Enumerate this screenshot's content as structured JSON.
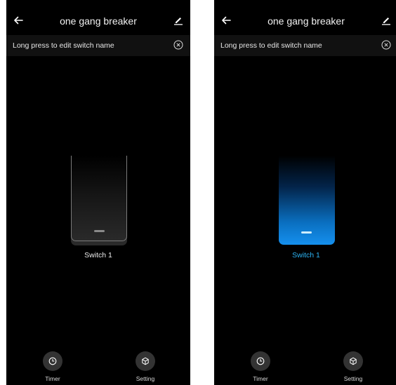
{
  "screens": [
    {
      "title": "one gang breaker",
      "banner": "Long press to edit switch name",
      "switch": {
        "label": "Switch 1",
        "state": "off",
        "color": "#7b7b7b"
      },
      "buttons": {
        "timer_label": "Timer",
        "setting_label": "Setting"
      }
    },
    {
      "title": "one gang breaker",
      "banner": "Long press to edit switch name",
      "switch": {
        "label": "Switch 1",
        "state": "on",
        "color": "#1590ee"
      },
      "buttons": {
        "timer_label": "Timer",
        "setting_label": "Setting"
      }
    }
  ],
  "icons": {
    "back": "arrow-left-icon",
    "edit": "pencil-icon",
    "close": "circle-x-icon",
    "timer": "clock-icon",
    "setting": "cube-icon"
  },
  "colors": {
    "background": "#000000",
    "accent": "#2cb4f4",
    "button_bg": "#333333"
  }
}
